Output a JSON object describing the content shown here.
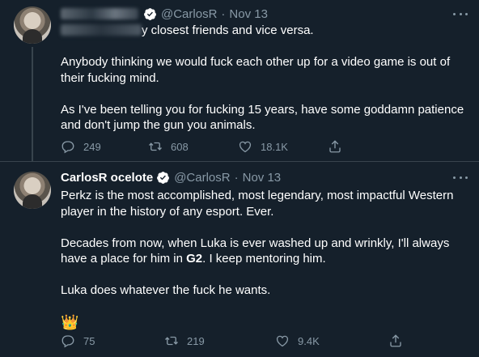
{
  "tweet1": {
    "name": "",
    "handle": "@CarlosR",
    "dot": "·",
    "date": "Nov 13",
    "paragraphs": [
      "y closest friends and vice versa.",
      "Anybody thinking we would fuck each other up for a video game is out of their fucking mind.",
      "As I've been telling you for fucking 15 years, have some goddamn patience and don't jump the gun you animals."
    ],
    "actions": {
      "reply_count": "249",
      "retweet_count": "608",
      "like_count": "18.1K"
    }
  },
  "tweet2": {
    "name": "CarlosR ocelote",
    "handle": "@CarlosR",
    "dot": "·",
    "date": "Nov 13",
    "paragraph1": "Perkz is the most accomplished, most legendary, most impactful Western player in the history of any esport. Ever.",
    "paragraph2_before": "Decades from now, when Luka is ever washed up and wrinkly, I'll always have a place for him in ",
    "paragraph2_bold": "G2",
    "paragraph2_after": ". I keep mentoring him.",
    "paragraph3": "Luka does whatever the fuck he wants.",
    "emoji": "👑",
    "actions": {
      "reply_count": "75",
      "retweet_count": "219",
      "like_count": "9.4K"
    }
  },
  "colors": {
    "background": "#15202b",
    "text": "#ffffff",
    "secondary": "#8899a6",
    "border": "#38444d",
    "verified": "#ffffff"
  },
  "icons": [
    "verified-badge-icon",
    "more-icon",
    "reply-icon",
    "retweet-icon",
    "like-icon",
    "share-icon"
  ]
}
